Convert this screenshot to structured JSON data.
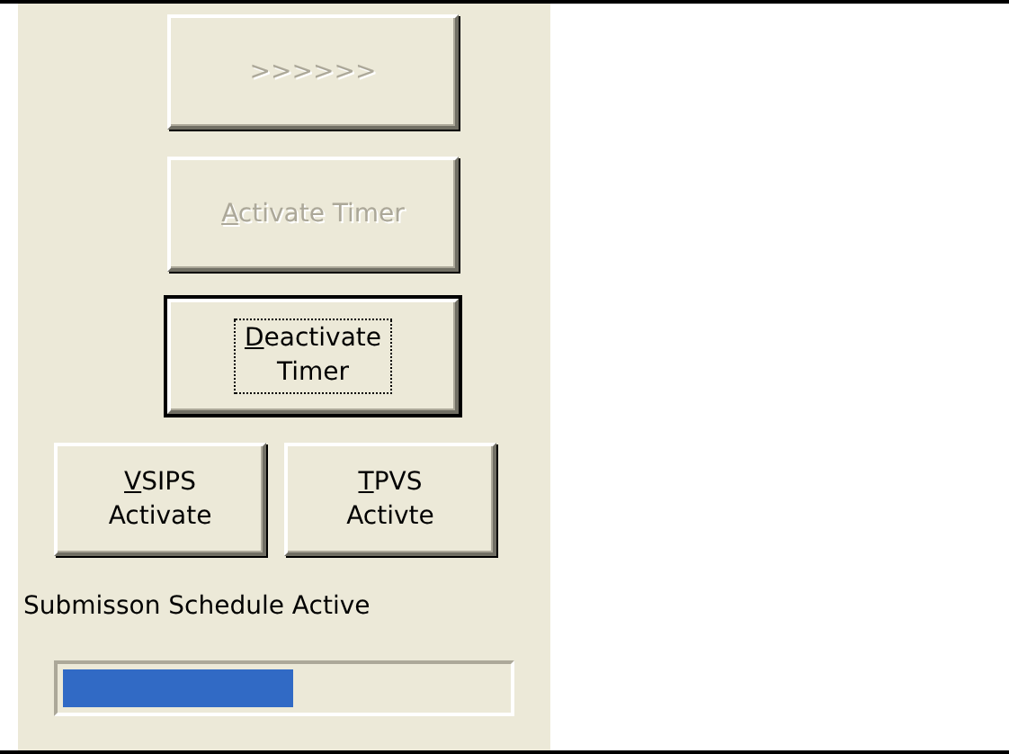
{
  "buttons": [
    {
      "label": ">>>>>>",
      "disabled": true,
      "focused": false,
      "access_key": false
    },
    {
      "label": "Activate Timer",
      "disabled": true,
      "focused": false,
      "access_key": true
    },
    {
      "label": "Deactivate\nTimer",
      "disabled": false,
      "focused": true,
      "access_key": true
    }
  ],
  "pair_buttons": [
    {
      "label": "VSIPS\nActivate",
      "disabled": false,
      "focused": false,
      "access_key": true
    },
    {
      "label": "TPVS\nActivte",
      "disabled": false,
      "focused": false,
      "access_key": true
    }
  ],
  "status_label": "Submisson Schedule Active",
  "progress": {
    "level": 0.52
  }
}
